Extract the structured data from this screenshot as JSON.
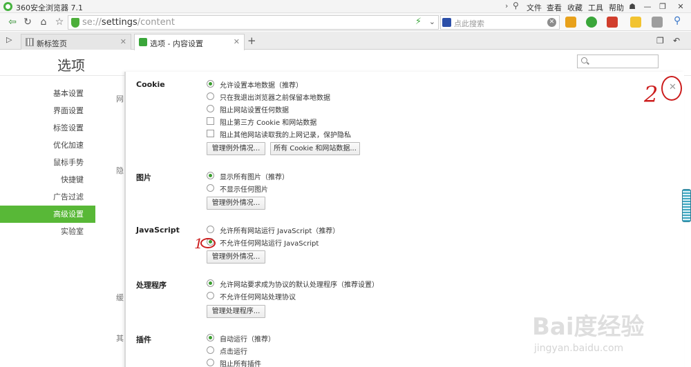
{
  "window": {
    "title": "360安全浏览器 7.1",
    "menu": [
      "文件",
      "查看",
      "收藏",
      "工具",
      "帮助"
    ],
    "controls": [
      "—",
      "❐",
      "✕"
    ]
  },
  "toolbar": {
    "url_prefix": "se://",
    "url_main": "settings",
    "url_suffix": "/content",
    "search_placeholder": "点此搜索"
  },
  "tabs": [
    {
      "label": "新标签页",
      "close": "✕"
    },
    {
      "label": "选项 - 内容设置",
      "close": "✕"
    }
  ],
  "page": {
    "heading": "选项"
  },
  "sidebar": {
    "items": [
      {
        "label": "基本设置"
      },
      {
        "label": "界面设置"
      },
      {
        "label": "标签设置"
      },
      {
        "label": "优化加速"
      },
      {
        "label": "鼠标手势"
      },
      {
        "label": "快捷键"
      },
      {
        "label": "广告过滤"
      },
      {
        "label": "高级设置"
      },
      {
        "label": "实验室"
      }
    ],
    "active_index": 7
  },
  "background_chars": [
    "网",
    "隐",
    "缓",
    "其"
  ],
  "dialog": {
    "close": "✕",
    "cookie": {
      "title": "Cookie",
      "options": [
        {
          "type": "radio",
          "checked": true,
          "label": "允许设置本地数据（推荐）"
        },
        {
          "type": "radio",
          "checked": false,
          "label": "只在我退出浏览器之前保留本地数据"
        },
        {
          "type": "radio",
          "checked": false,
          "label": "阻止网站设置任何数据"
        },
        {
          "type": "checkbox",
          "checked": false,
          "label": "阻止第三方 Cookie 和网站数据"
        },
        {
          "type": "checkbox",
          "checked": false,
          "label": "阻止其他网站读取我的上网记录，保护隐私"
        }
      ],
      "buttons": [
        "管理例外情况...",
        "所有 Cookie 和网站数据..."
      ]
    },
    "images": {
      "title": "图片",
      "options": [
        {
          "type": "radio",
          "checked": true,
          "label": "显示所有图片（推荐）"
        },
        {
          "type": "radio",
          "checked": false,
          "label": "不显示任何图片"
        }
      ],
      "buttons": [
        "管理例外情况..."
      ]
    },
    "javascript": {
      "title": "JavaScript",
      "options": [
        {
          "type": "radio",
          "checked": false,
          "label": "允许所有网站运行 JavaScript（推荐）"
        },
        {
          "type": "radio",
          "checked": true,
          "label": "不允许任何网站运行 JavaScript"
        }
      ],
      "buttons": [
        "管理例外情况..."
      ]
    },
    "handlers": {
      "title": "处理程序",
      "options": [
        {
          "type": "radio",
          "checked": true,
          "label": "允许网站要求成为协议的默认处理程序（推荐设置）"
        },
        {
          "type": "radio",
          "checked": false,
          "label": "不允许任何网站处理协议"
        }
      ],
      "buttons": [
        "管理处理程序..."
      ]
    },
    "plugins": {
      "title": "插件",
      "options": [
        {
          "type": "radio",
          "checked": true,
          "label": "自动运行（推荐）"
        },
        {
          "type": "radio",
          "checked": false,
          "label": "点击运行"
        },
        {
          "type": "radio",
          "checked": false,
          "label": "阻止所有插件"
        }
      ]
    }
  },
  "annotations": {
    "one": "1",
    "two": "2"
  },
  "watermark": {
    "main": "Bai度经验",
    "sub": "jingyan.baidu.com"
  },
  "colors": {
    "accent": "#58b837",
    "annotation": "#cc1d1d"
  }
}
